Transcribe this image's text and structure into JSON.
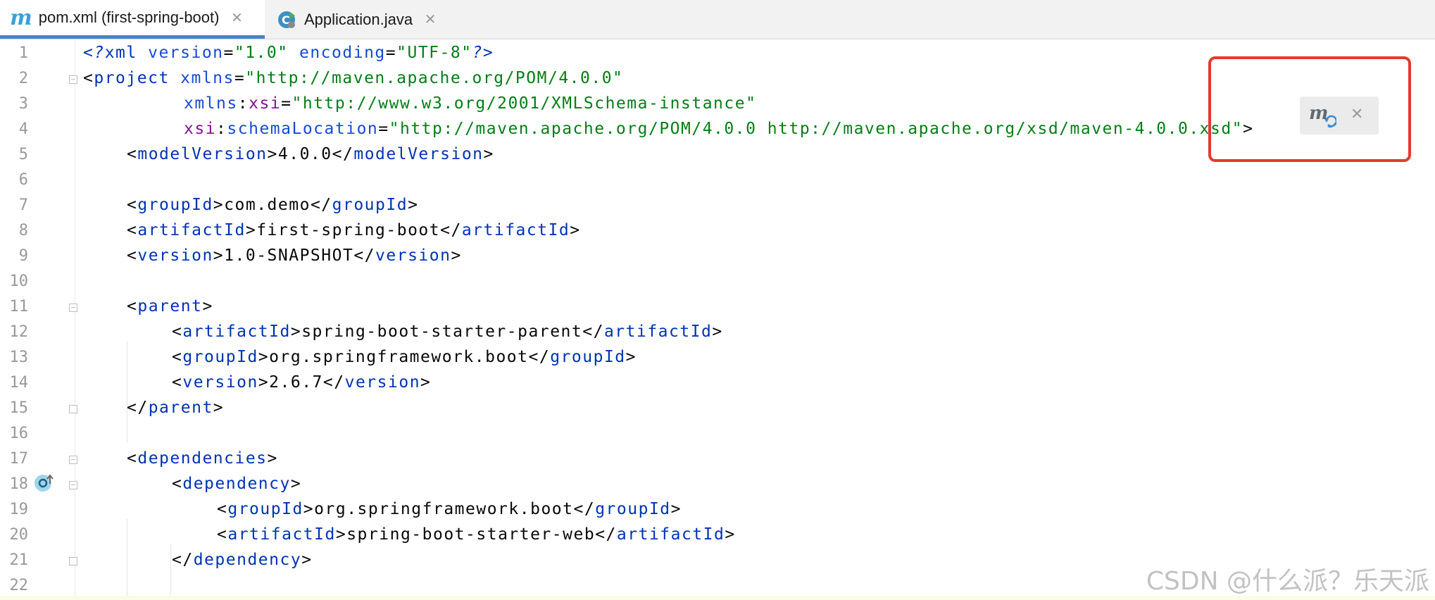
{
  "tabs": [
    {
      "label": "pom.xml (first-spring-boot)",
      "icon": "maven-icon",
      "active": true
    },
    {
      "label": "Application.java",
      "icon": "java-class-icon",
      "active": false
    }
  ],
  "tab_close_glyph": "✕",
  "lines": [
    {
      "n": "1"
    },
    {
      "n": "2"
    },
    {
      "n": "3"
    },
    {
      "n": "4"
    },
    {
      "n": "5"
    },
    {
      "n": "6"
    },
    {
      "n": "7"
    },
    {
      "n": "8"
    },
    {
      "n": "9"
    },
    {
      "n": "10"
    },
    {
      "n": "11"
    },
    {
      "n": "12"
    },
    {
      "n": "13"
    },
    {
      "n": "14"
    },
    {
      "n": "15"
    },
    {
      "n": "16"
    },
    {
      "n": "17"
    },
    {
      "n": "18"
    },
    {
      "n": "19"
    },
    {
      "n": "20"
    },
    {
      "n": "21"
    },
    {
      "n": "22"
    }
  ],
  "code": {
    "l1": {
      "pi_open": "<?",
      "pi_name": "xml",
      "a1": " version",
      "eq1": "=",
      "v1": "\"1.0\"",
      "a2": " encoding",
      "eq2": "=",
      "v2": "\"UTF-8\"",
      "pi_close": "?>"
    },
    "l2": {
      "lt": "<",
      "tag": "project",
      "attr": " xmlns",
      "eq": "=",
      "val": "\"http://maven.apache.org/POM/4.0.0\""
    },
    "l3": {
      "ns": "xmlns",
      "colon": ":",
      "attr": "xsi",
      "eq": "=",
      "val": "\"http://www.w3.org/2001/XMLSchema-instance\""
    },
    "l4": {
      "ns": "xsi",
      "colon": ":",
      "attr": "schemaLocation",
      "eq": "=",
      "val": "\"http://maven.apache.org/POM/4.0.0 http://maven.apache.org/xsd/maven-4.0.0.xsd\"",
      "gt": ">"
    },
    "l5": {
      "tag": "modelVersion",
      "text": "4.0.0"
    },
    "l7": {
      "tag": "groupId",
      "text": "com.demo"
    },
    "l8": {
      "tag": "artifactId",
      "text": "first-spring-boot"
    },
    "l9": {
      "tag": "version",
      "text": "1.0-SNAPSHOT"
    },
    "l11": {
      "tag": "parent"
    },
    "l12": {
      "tag": "artifactId",
      "text": "spring-boot-starter-parent"
    },
    "l13": {
      "tag": "groupId",
      "text": "org.springframework.boot"
    },
    "l14": {
      "tag": "version",
      "text": "2.6.7"
    },
    "l15": {
      "tag": "parent"
    },
    "l17": {
      "tag": "dependencies"
    },
    "l18": {
      "tag": "dependency"
    },
    "l19": {
      "tag": "groupId",
      "text": "org.springframework.boot"
    },
    "l20": {
      "tag": "artifactId",
      "text": "spring-boot-starter-web"
    },
    "l21": {
      "tag": "dependency"
    }
  },
  "maven_popup": {
    "reload_icon": "maven-reload-icon",
    "close_glyph": "✕"
  },
  "watermark": "CSDN @什么派？乐天派",
  "colors": {
    "tag": "#0033b3",
    "attribute": "#174ad4",
    "namespace": "#871094",
    "value": "#067d17",
    "highlight": "#e23b2e",
    "active_tab_underline": "#4a83c4"
  }
}
